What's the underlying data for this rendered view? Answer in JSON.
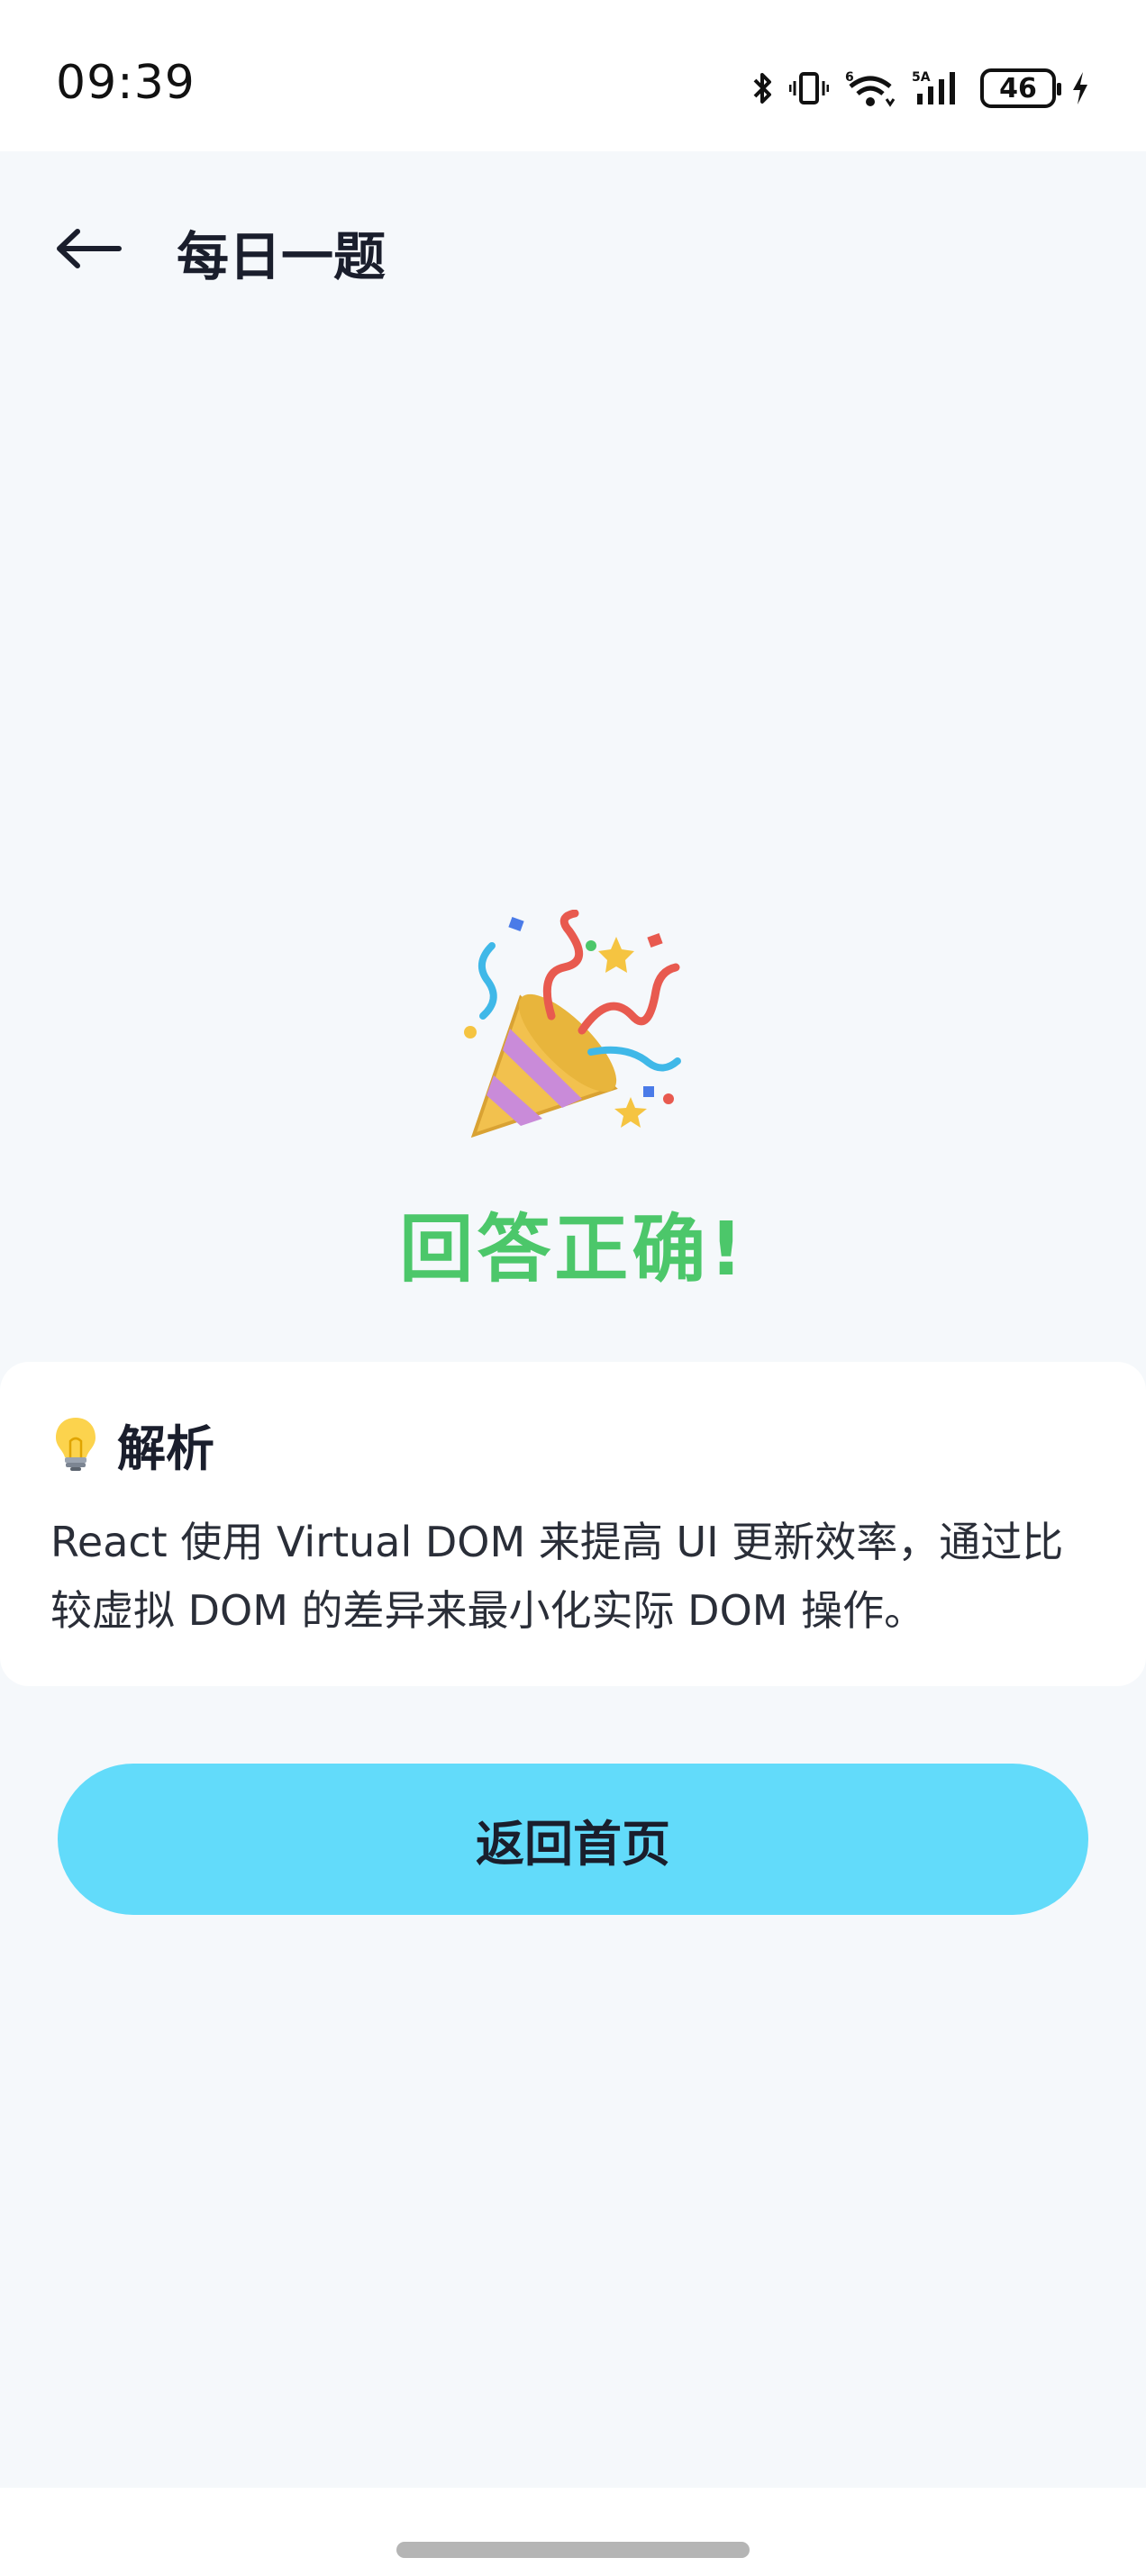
{
  "status_bar": {
    "time": "09:39",
    "wifi_label": "6",
    "signal_label": "5A",
    "battery_level": "46",
    "icons": [
      "bluetooth-icon",
      "vibrate-icon",
      "wifi-icon",
      "signal-icon",
      "battery-icon",
      "charging-icon"
    ]
  },
  "header": {
    "title": "每日一题",
    "back_icon": "arrow-left-icon"
  },
  "result": {
    "icon": "party-popper-icon",
    "title": "回答正确!",
    "title_color": "#4cc76a"
  },
  "analysis": {
    "icon": "lightbulb-icon",
    "title": "解析",
    "text": "React 使用 Virtual DOM 来提高 UI 更新效率，通过比较虚拟 DOM 的差异来最小化实际 DOM 操作。"
  },
  "actions": {
    "home_button": "返回首页",
    "button_color": "#62dbfa"
  }
}
